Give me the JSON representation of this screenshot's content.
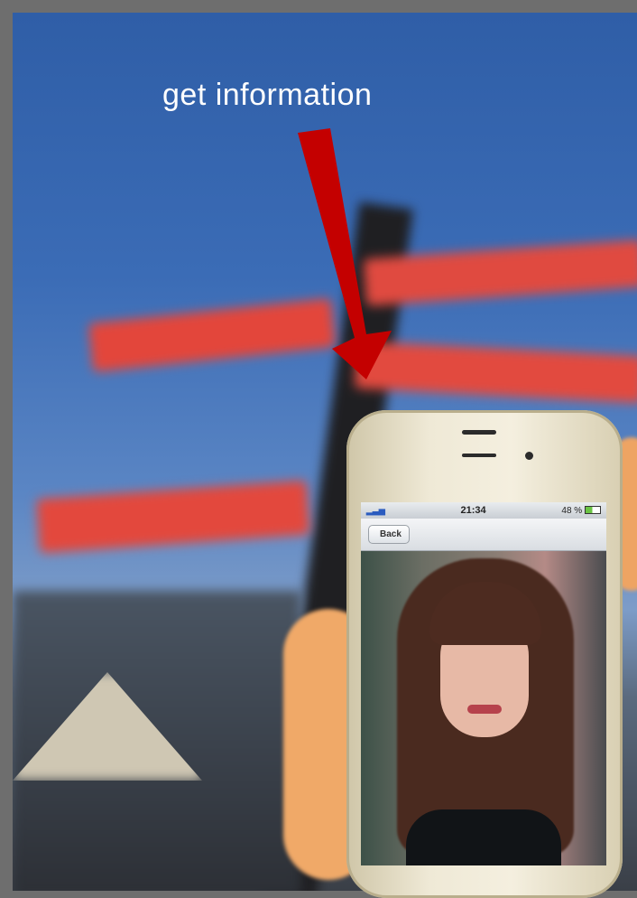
{
  "caption": "get information",
  "phone": {
    "status": {
      "time": "21:34",
      "battery": "48 %"
    },
    "back_label": "Back"
  },
  "colors": {
    "arrow": "#c40000",
    "sign": "#e0443a",
    "sky": "#3b6cb6"
  }
}
